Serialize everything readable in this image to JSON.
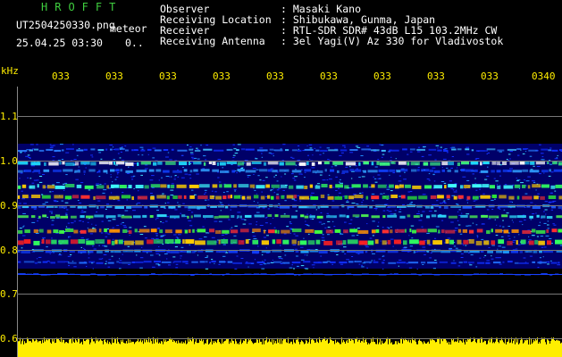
{
  "header": {
    "brand": "HROFFT",
    "filename": "UT2504250330.png",
    "meteor_label": "meteor",
    "datetime": "25.04.25 03:30",
    "flag": "0.."
  },
  "info": [
    {
      "label": "Observer",
      "value": ": Masaki Kano"
    },
    {
      "label": "Receiving Location",
      "value": ": Shibukawa, Gunma, Japan"
    },
    {
      "label": "Receiver",
      "value": ": RTL-SDR SDR# 43dB L15 103.2MHz CW"
    },
    {
      "label": "Receiving Antenna",
      "value": ": 3el Yagi(V) Az 330 for Vladivostok"
    }
  ],
  "axis": {
    "unit": "kHz",
    "time_ticks": [
      "033",
      "033",
      "033",
      "033",
      "033",
      "033",
      "033",
      "033",
      "033",
      "0340"
    ],
    "freq_ticks": [
      "1.1",
      "1.0",
      "0.9",
      "0.8",
      "0.7",
      "0.6"
    ]
  },
  "colors": {
    "label": "#ffee00",
    "brand": "#3fce3f",
    "text": "#ffffff",
    "noise_band": "#ffee00"
  }
}
